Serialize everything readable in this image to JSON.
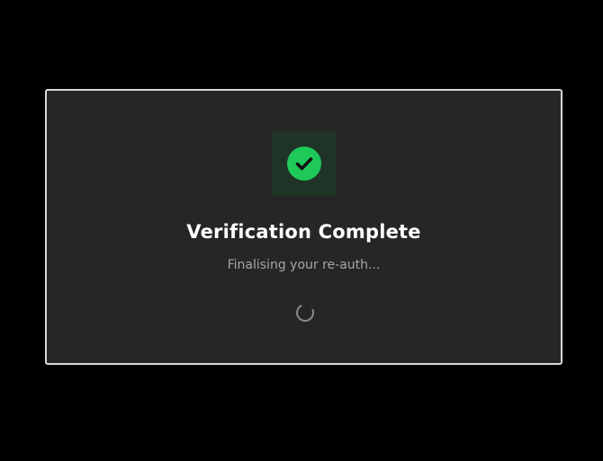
{
  "modal": {
    "title": "Verification Complete",
    "subtitle": "Finalising your re-auth...",
    "status_icon": "check-circle-icon",
    "loading_icon": "spinner-icon"
  },
  "colors": {
    "background": "#000000",
    "modal_background": "#262626",
    "modal_border": "#d9d9d9",
    "success_green": "#1ec95a",
    "icon_box_background": "#1f3326",
    "title_text": "#ffffff",
    "subtitle_text": "#a6a6a6",
    "spinner": "#8c8c8c"
  }
}
